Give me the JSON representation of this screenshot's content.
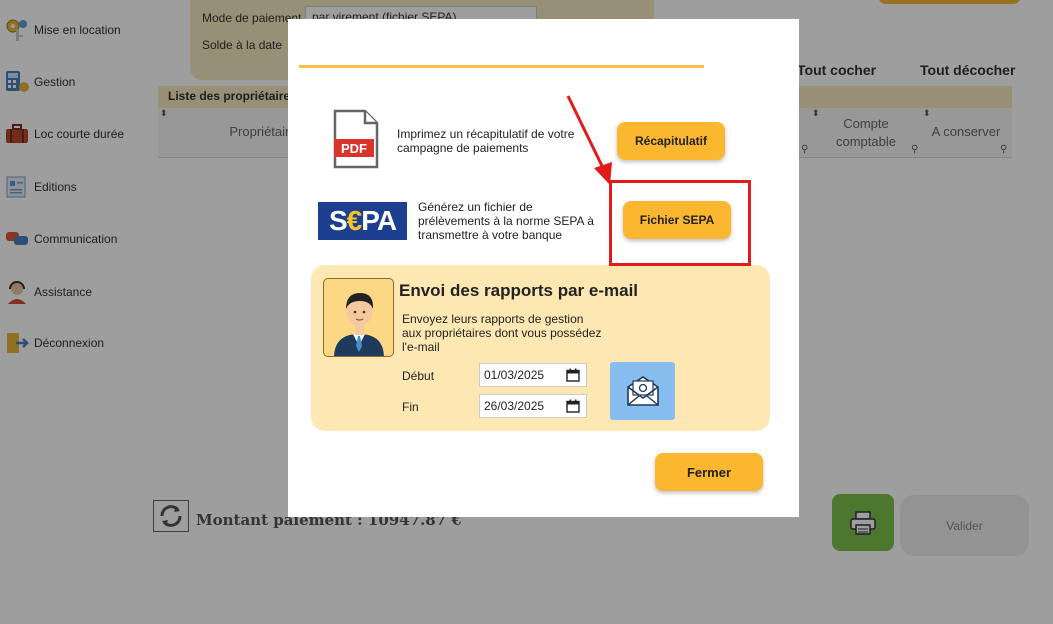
{
  "sidebar": {
    "items": [
      {
        "label": "Mise en location",
        "icon": "keys-icon"
      },
      {
        "label": "Gestion",
        "icon": "calculator-icon"
      },
      {
        "label": "Loc courte durée",
        "icon": "suitcase-icon"
      },
      {
        "label": "Editions",
        "icon": "document-icon"
      },
      {
        "label": "Communication",
        "icon": "chat-icon"
      },
      {
        "label": "Assistance",
        "icon": "headset-icon"
      },
      {
        "label": "Déconnexion",
        "icon": "logout-icon"
      }
    ]
  },
  "background": {
    "payment_mode_label": "Mode de paiement",
    "payment_mode_value": "par virement (fichier SEPA)",
    "balance_label": "Solde à la date",
    "check_all": "Tout cocher",
    "uncheck_all": "Tout décocher",
    "list_title": "Liste des propriétaires",
    "columns": {
      "owner": "Propriétaire",
      "account": "Compte comptable",
      "keep": "A conserver"
    },
    "amount_text": "Montant paiement : 10947.87 €",
    "validate_label": "Valider"
  },
  "modal": {
    "pdf_label": "PDF",
    "summary_text": "Imprimez un récapitulatif de votre campagne de paiements",
    "summary_button": "Récapitulatif",
    "sepa_logo": "S€PA",
    "sepa_text": "Générez un fichier de prélèvements à la norme SEPA à transmettre à votre banque",
    "sepa_button": "Fichier SEPA",
    "email": {
      "title": "Envoi des rapports par e-mail",
      "description": "Envoyez leurs rapports de gestion aux propriétaires dont vous possédez l'e-mail",
      "start_label": "Début",
      "start_value": "01/03/2025",
      "end_label": "Fin",
      "end_value": "26/03/2025"
    },
    "close_button": "Fermer"
  },
  "colors": {
    "accent_yellow": "#fbb730",
    "panel_cream": "#fde8b3",
    "annotation_red": "#e01b1b",
    "send_blue": "#88bdf0",
    "print_green": "#7cc04b"
  }
}
